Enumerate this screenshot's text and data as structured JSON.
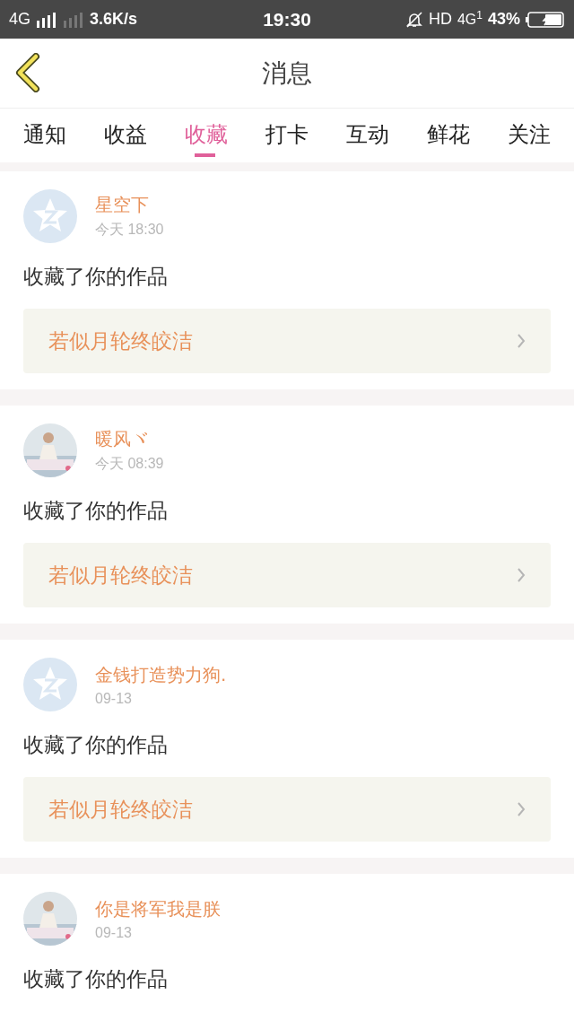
{
  "status_bar": {
    "network": "4G",
    "speed": "3.6K/s",
    "time": "19:30",
    "hd": "HD",
    "network_right": "4G",
    "sim": "1",
    "battery": "43%"
  },
  "header": {
    "title": "消息"
  },
  "tabs": [
    {
      "label": "通知",
      "selected": false
    },
    {
      "label": "收益",
      "selected": false
    },
    {
      "label": "收藏",
      "selected": true
    },
    {
      "label": "打卡",
      "selected": false
    },
    {
      "label": "互动",
      "selected": false
    },
    {
      "label": "鲜花",
      "selected": false
    },
    {
      "label": "关注",
      "selected": false
    }
  ],
  "messages": [
    {
      "avatar": {
        "kind": "default"
      },
      "name": "星空下",
      "time": "今天 18:30",
      "text": "收藏了你的作品",
      "link": "若似月轮终皎洁"
    },
    {
      "name": "暖风ヾ",
      "time": "今天 08:39",
      "text": "收藏了你的作品",
      "link": "若似月轮终皎洁"
    },
    {
      "avatar": {
        "kind": "default"
      },
      "name": "金钱打造势力狗.",
      "time": "09-13",
      "text": "收藏了你的作品",
      "link": "若似月轮终皎洁"
    },
    {
      "name": "你是将军我是朕",
      "time": "09-13",
      "text": "收藏了你的作品"
    }
  ]
}
